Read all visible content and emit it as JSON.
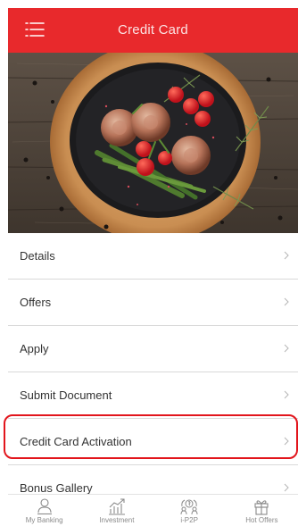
{
  "header": {
    "title": "Credit Card",
    "menu_icon": "hamburger-menu-icon",
    "background_color": "#e8292c"
  },
  "hero": {
    "image": "plated-steak-with-tomatoes-and-asparagus"
  },
  "menu": {
    "items": [
      {
        "label": "Details"
      },
      {
        "label": "Offers"
      },
      {
        "label": "Apply"
      },
      {
        "label": "Submit Document"
      },
      {
        "label": "Credit Card Activation",
        "highlighted": true
      },
      {
        "label": "Bonus Gallery"
      }
    ],
    "chevron_icon": "chevron-right-icon",
    "highlight_color": "#e2151c"
  },
  "tabbar": {
    "tabs": [
      {
        "label": "My Banking",
        "icon": "person-icon"
      },
      {
        "label": "Investment",
        "icon": "growth-chart-icon"
      },
      {
        "label": "i-P2P",
        "icon": "p2p-transfer-icon"
      },
      {
        "label": "Hot Offers",
        "icon": "gift-icon"
      }
    ]
  }
}
